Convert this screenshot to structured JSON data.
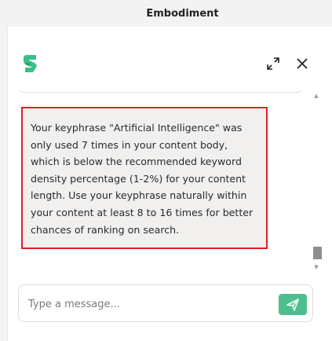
{
  "window": {
    "title": "Embodiment"
  },
  "header": {
    "logo_icon": "brand-logo-icon",
    "expand_icon": "expand-icon",
    "close_icon": "close-icon"
  },
  "messages": [
    {
      "text": "Your keyphrase \"Artificial Intelligence\" was only used 7 times in your content body, which is below the recommended keyword density percentage (1-2%) for your content length. Use your keyphrase naturally within your content at least 8 to 16 times for better chances of ranking on search."
    }
  ],
  "composer": {
    "placeholder": "Type a message...",
    "value": "",
    "send_icon": "send-icon"
  },
  "colors": {
    "brand": "#3bbf8a",
    "send_button": "#4cbf8c",
    "highlight_border": "#e11e23",
    "message_bg": "#f1f0ef"
  }
}
